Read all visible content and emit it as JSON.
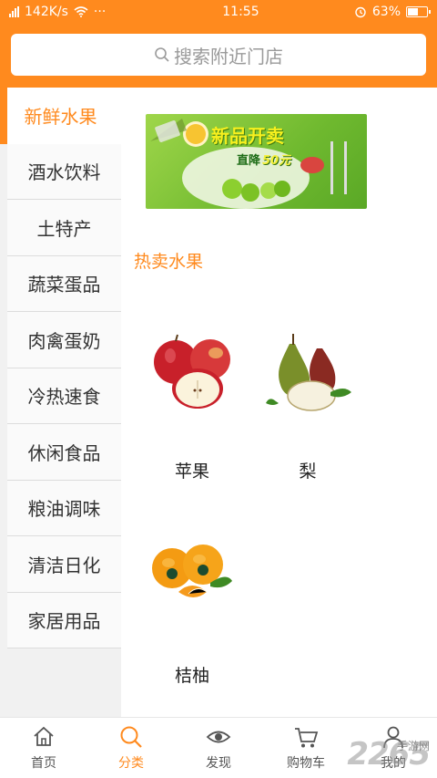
{
  "status_bar": {
    "net_speed": "142K/s",
    "dots": "···",
    "time": "11:55",
    "battery": "63%",
    "battery_level": 0.63
  },
  "search": {
    "placeholder": "搜索附近门店"
  },
  "sidebar": {
    "items": [
      {
        "label": "新鲜水果",
        "active": true
      },
      {
        "label": "酒水饮料"
      },
      {
        "label": "土特产"
      },
      {
        "label": "蔬菜蛋品"
      },
      {
        "label": "肉禽蛋奶"
      },
      {
        "label": "冷热速食"
      },
      {
        "label": "休闲食品"
      },
      {
        "label": "粮油调味"
      },
      {
        "label": "清洁日化"
      },
      {
        "label": "家居用品"
      }
    ]
  },
  "banner": {
    "title": "新品开卖",
    "subtitle": "直降",
    "amount": "50元"
  },
  "section": {
    "title": "热卖水果"
  },
  "products": [
    {
      "name": "苹果",
      "icon": "apple-image"
    },
    {
      "name": "梨",
      "icon": "pear-image"
    },
    {
      "name": "桔柚",
      "icon": "orange-image"
    }
  ],
  "bottom_nav": {
    "items": [
      {
        "label": "首页",
        "icon": "home-icon"
      },
      {
        "label": "分类",
        "icon": "search-icon",
        "active": true
      },
      {
        "label": "发现",
        "icon": "eye-icon"
      },
      {
        "label": "购物车",
        "icon": "cart-icon"
      },
      {
        "label": "我的",
        "icon": "user-icon"
      }
    ]
  },
  "watermark": {
    "brand": "2265",
    "site": "手游网"
  },
  "colors": {
    "accent": "#ff8a1e",
    "text": "#333333"
  }
}
